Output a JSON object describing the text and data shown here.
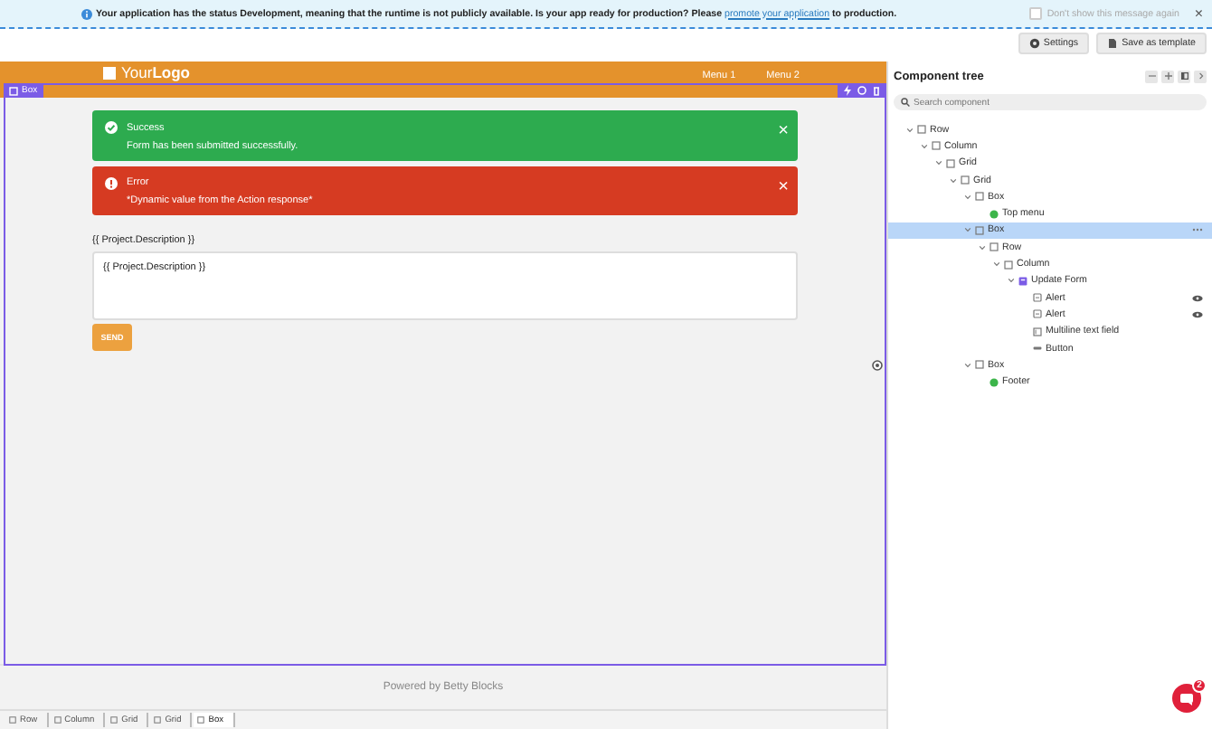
{
  "banner": {
    "text_before": "Your application has the status Development, meaning that the runtime is not publicly available. Is your app ready for production? Please",
    "link": "promote your application",
    "text_after": "to production.",
    "dismiss_label": "Don't show this message again",
    "dismiss_checked": false,
    "close": "×"
  },
  "toolbar": {
    "buttons": [
      {
        "label": "Settings",
        "kind": "settings"
      },
      {
        "label": "Save as template",
        "kind": "template"
      }
    ]
  },
  "canvas": {
    "header": {
      "logo": "Your**Logo**",
      "menu": [
        "Menu 1",
        "Menu 2"
      ]
    },
    "selection": {
      "label": "Box"
    },
    "alerts": [
      {
        "kind": "success",
        "title": "Success",
        "message": "Form has been submitted successfully.",
        "close": "×"
      },
      {
        "kind": "error",
        "title": "Error",
        "message": "*Dynamic value from the Action response*",
        "close": "×"
      }
    ],
    "field": {
      "label": "{{ Project.Description }}",
      "value": "{{ Project.Description }}"
    },
    "button": "SEND",
    "footer": "Powered by Betty Blocks"
  },
  "component_tree": {
    "title": "Component tree",
    "search": {
      "placeholder": "Search component"
    },
    "items": [
      {
        "label": "Row",
        "kind": "box",
        "expanded": true,
        "selected": false,
        "eye": false,
        "children": [
          {
            "label": "Column",
            "kind": "box",
            "expanded": true,
            "selected": false,
            "eye": false,
            "children": [
              {
                "label": "Grid",
                "kind": "box",
                "expanded": true,
                "selected": false,
                "eye": false,
                "children": [
                  {
                    "label": "Grid",
                    "kind": "box",
                    "expanded": true,
                    "selected": false,
                    "eye": false,
                    "children": [
                      {
                        "label": "Box",
                        "kind": "box",
                        "expanded": true,
                        "selected": false,
                        "eye": false,
                        "children": [
                          {
                            "label": "Top menu",
                            "kind": "partial",
                            "selected": false,
                            "eye": false
                          }
                        ]
                      },
                      {
                        "label": "Box",
                        "kind": "box",
                        "expanded": true,
                        "selected": true,
                        "eye": false,
                        "children": [
                          {
                            "label": "Row",
                            "kind": "box",
                            "expanded": true,
                            "selected": false,
                            "eye": false,
                            "children": [
                              {
                                "label": "Column",
                                "kind": "box",
                                "expanded": true,
                                "selected": false,
                                "eye": false,
                                "children": [
                                  {
                                    "label": "Update Form",
                                    "kind": "form",
                                    "expanded": true,
                                    "selected": false,
                                    "eye": false,
                                    "children": [
                                      {
                                        "label": "Alert",
                                        "kind": "alert",
                                        "selected": false,
                                        "eye": true
                                      },
                                      {
                                        "label": "Alert",
                                        "kind": "alert",
                                        "selected": false,
                                        "eye": true
                                      },
                                      {
                                        "label": "Multiline text field",
                                        "kind": "field",
                                        "selected": false,
                                        "eye": false
                                      },
                                      {
                                        "label": "Button",
                                        "kind": "button",
                                        "selected": false,
                                        "eye": false
                                      }
                                    ]
                                  }
                                ]
                              }
                            ]
                          }
                        ]
                      },
                      {
                        "label": "Box",
                        "kind": "box",
                        "expanded": true,
                        "selected": false,
                        "eye": false,
                        "children": [
                          {
                            "label": "Footer",
                            "kind": "partial",
                            "selected": false,
                            "eye": false
                          }
                        ]
                      }
                    ]
                  }
                ]
              }
            ]
          }
        ]
      }
    ]
  },
  "breadcrumbs": [
    "Row",
    "Column",
    "Grid",
    "Grid",
    "Box"
  ],
  "chat": {
    "badge": "2"
  }
}
